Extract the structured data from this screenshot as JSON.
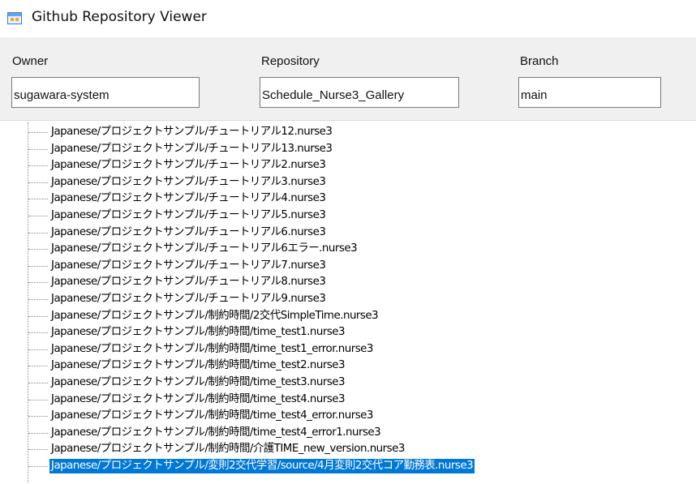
{
  "window": {
    "title": "Github Repository Viewer"
  },
  "form": {
    "owner_label": "Owner",
    "owner_value": "sugawara-system",
    "repository_label": "Repository",
    "repository_value": "Schedule_Nurse3_Gallery",
    "branch_label": "Branch",
    "branch_value": "main"
  },
  "tree": {
    "items": [
      "Japanese/プロジェクトサンプル/チュートリアル12.nurse3",
      "Japanese/プロジェクトサンプル/チュートリアル13.nurse3",
      "Japanese/プロジェクトサンプル/チュートリアル2.nurse3",
      "Japanese/プロジェクトサンプル/チュートリアル3.nurse3",
      "Japanese/プロジェクトサンプル/チュートリアル4.nurse3",
      "Japanese/プロジェクトサンプル/チュートリアル5.nurse3",
      "Japanese/プロジェクトサンプル/チュートリアル6.nurse3",
      "Japanese/プロジェクトサンプル/チュートリアル6エラー.nurse3",
      "Japanese/プロジェクトサンプル/チュートリアル7.nurse3",
      "Japanese/プロジェクトサンプル/チュートリアル8.nurse3",
      "Japanese/プロジェクトサンプル/チュートリアル9.nurse3",
      "Japanese/プロジェクトサンプル/制約時間/2交代SimpleTime.nurse3",
      "Japanese/プロジェクトサンプル/制約時間/time_test1.nurse3",
      "Japanese/プロジェクトサンプル/制約時間/time_test1_error.nurse3",
      "Japanese/プロジェクトサンプル/制約時間/time_test2.nurse3",
      "Japanese/プロジェクトサンプル/制約時間/time_test3.nurse3",
      "Japanese/プロジェクトサンプル/制約時間/time_test4.nurse3",
      "Japanese/プロジェクトサンプル/制約時間/time_test4_error.nurse3",
      "Japanese/プロジェクトサンプル/制約時間/time_test4_error1.nurse3",
      "Japanese/プロジェクトサンプル/制約時間/介護TIME_new_version.nurse3",
      "Japanese/プロジェクトサンプル/変則2交代学習/source/4月変則2交代コア勤務表.nurse3"
    ],
    "selected_index": 20
  },
  "colors": {
    "selection": "#0078d7",
    "form_background": "#f0f0f0"
  },
  "icons": {
    "app": "window-app-icon"
  }
}
